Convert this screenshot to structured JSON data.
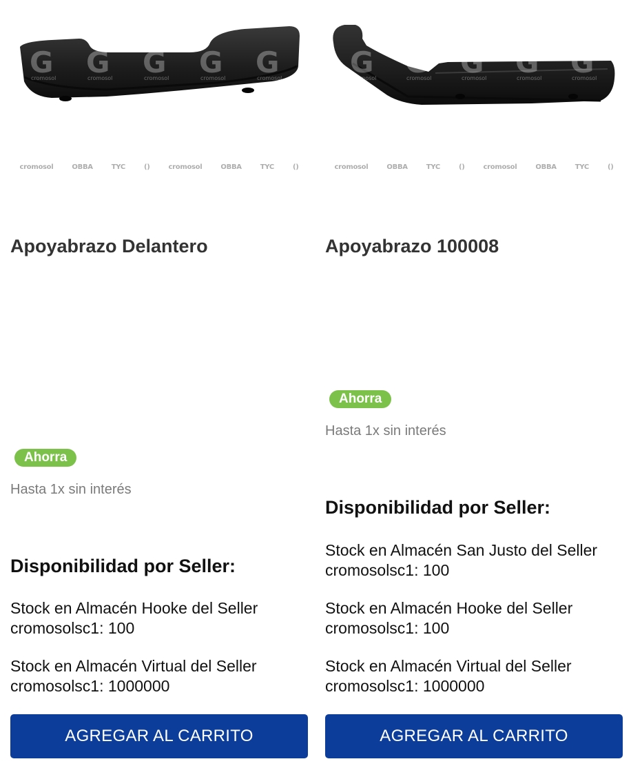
{
  "colors": {
    "badge": "#7cc24a",
    "button": "#0d3d9b",
    "title": "#333333",
    "muted": "#7a7a7a"
  },
  "products": [
    {
      "image_alt": "Apoyabrazo Delantero",
      "watermark": "cromosol",
      "brands": [
        "cromosol",
        "OBBA",
        "TYC",
        "()",
        "cromosol",
        "OBBA",
        "TYC",
        "()"
      ],
      "title": "Apoyabrazo Delantero",
      "badge": "Ahorra",
      "installments": "Hasta 1x sin interés",
      "availability_heading": "Disponibilidad por Seller:",
      "stock": [
        "Stock en Almacén Hooke del Seller cromosolsc1: 100",
        "Stock en Almacén Virtual del Seller cromosolsc1: 1000000"
      ],
      "cart_label": "AGREGAR AL CARRITO"
    },
    {
      "image_alt": "Apoyabrazo 100008",
      "watermark": "cromosol",
      "brands": [
        "cromosol",
        "OBBA",
        "TYC",
        "()",
        "cromosol",
        "OBBA",
        "TYC",
        "()"
      ],
      "title": "Apoyabrazo 100008",
      "badge": "Ahorra",
      "installments": "Hasta 1x sin interés",
      "availability_heading": "Disponibilidad por Seller:",
      "stock": [
        "Stock en Almacén San Justo del Seller cromosolsc1: 100",
        "Stock en Almacén Hooke del Seller cromosolsc1: 100",
        "Stock en Almacén Virtual del Seller cromosolsc1: 1000000"
      ],
      "cart_label": "AGREGAR AL CARRITO"
    }
  ]
}
